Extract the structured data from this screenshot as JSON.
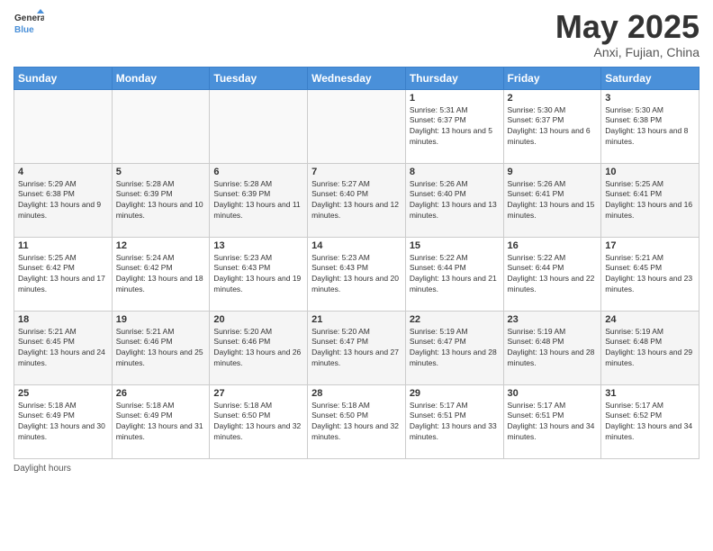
{
  "header": {
    "logo_general": "General",
    "logo_blue": "Blue",
    "month_title": "May 2025",
    "location": "Anxi, Fujian, China"
  },
  "footer": {
    "label": "Daylight hours"
  },
  "days_of_week": [
    "Sunday",
    "Monday",
    "Tuesday",
    "Wednesday",
    "Thursday",
    "Friday",
    "Saturday"
  ],
  "weeks": [
    [
      {
        "day": "",
        "info": ""
      },
      {
        "day": "",
        "info": ""
      },
      {
        "day": "",
        "info": ""
      },
      {
        "day": "",
        "info": ""
      },
      {
        "day": "1",
        "info": "Sunrise: 5:31 AM\nSunset: 6:37 PM\nDaylight: 13 hours and 5 minutes."
      },
      {
        "day": "2",
        "info": "Sunrise: 5:30 AM\nSunset: 6:37 PM\nDaylight: 13 hours and 6 minutes."
      },
      {
        "day": "3",
        "info": "Sunrise: 5:30 AM\nSunset: 6:38 PM\nDaylight: 13 hours and 8 minutes."
      }
    ],
    [
      {
        "day": "4",
        "info": "Sunrise: 5:29 AM\nSunset: 6:38 PM\nDaylight: 13 hours and 9 minutes."
      },
      {
        "day": "5",
        "info": "Sunrise: 5:28 AM\nSunset: 6:39 PM\nDaylight: 13 hours and 10 minutes."
      },
      {
        "day": "6",
        "info": "Sunrise: 5:28 AM\nSunset: 6:39 PM\nDaylight: 13 hours and 11 minutes."
      },
      {
        "day": "7",
        "info": "Sunrise: 5:27 AM\nSunset: 6:40 PM\nDaylight: 13 hours and 12 minutes."
      },
      {
        "day": "8",
        "info": "Sunrise: 5:26 AM\nSunset: 6:40 PM\nDaylight: 13 hours and 13 minutes."
      },
      {
        "day": "9",
        "info": "Sunrise: 5:26 AM\nSunset: 6:41 PM\nDaylight: 13 hours and 15 minutes."
      },
      {
        "day": "10",
        "info": "Sunrise: 5:25 AM\nSunset: 6:41 PM\nDaylight: 13 hours and 16 minutes."
      }
    ],
    [
      {
        "day": "11",
        "info": "Sunrise: 5:25 AM\nSunset: 6:42 PM\nDaylight: 13 hours and 17 minutes."
      },
      {
        "day": "12",
        "info": "Sunrise: 5:24 AM\nSunset: 6:42 PM\nDaylight: 13 hours and 18 minutes."
      },
      {
        "day": "13",
        "info": "Sunrise: 5:23 AM\nSunset: 6:43 PM\nDaylight: 13 hours and 19 minutes."
      },
      {
        "day": "14",
        "info": "Sunrise: 5:23 AM\nSunset: 6:43 PM\nDaylight: 13 hours and 20 minutes."
      },
      {
        "day": "15",
        "info": "Sunrise: 5:22 AM\nSunset: 6:44 PM\nDaylight: 13 hours and 21 minutes."
      },
      {
        "day": "16",
        "info": "Sunrise: 5:22 AM\nSunset: 6:44 PM\nDaylight: 13 hours and 22 minutes."
      },
      {
        "day": "17",
        "info": "Sunrise: 5:21 AM\nSunset: 6:45 PM\nDaylight: 13 hours and 23 minutes."
      }
    ],
    [
      {
        "day": "18",
        "info": "Sunrise: 5:21 AM\nSunset: 6:45 PM\nDaylight: 13 hours and 24 minutes."
      },
      {
        "day": "19",
        "info": "Sunrise: 5:21 AM\nSunset: 6:46 PM\nDaylight: 13 hours and 25 minutes."
      },
      {
        "day": "20",
        "info": "Sunrise: 5:20 AM\nSunset: 6:46 PM\nDaylight: 13 hours and 26 minutes."
      },
      {
        "day": "21",
        "info": "Sunrise: 5:20 AM\nSunset: 6:47 PM\nDaylight: 13 hours and 27 minutes."
      },
      {
        "day": "22",
        "info": "Sunrise: 5:19 AM\nSunset: 6:47 PM\nDaylight: 13 hours and 28 minutes."
      },
      {
        "day": "23",
        "info": "Sunrise: 5:19 AM\nSunset: 6:48 PM\nDaylight: 13 hours and 28 minutes."
      },
      {
        "day": "24",
        "info": "Sunrise: 5:19 AM\nSunset: 6:48 PM\nDaylight: 13 hours and 29 minutes."
      }
    ],
    [
      {
        "day": "25",
        "info": "Sunrise: 5:18 AM\nSunset: 6:49 PM\nDaylight: 13 hours and 30 minutes."
      },
      {
        "day": "26",
        "info": "Sunrise: 5:18 AM\nSunset: 6:49 PM\nDaylight: 13 hours and 31 minutes."
      },
      {
        "day": "27",
        "info": "Sunrise: 5:18 AM\nSunset: 6:50 PM\nDaylight: 13 hours and 32 minutes."
      },
      {
        "day": "28",
        "info": "Sunrise: 5:18 AM\nSunset: 6:50 PM\nDaylight: 13 hours and 32 minutes."
      },
      {
        "day": "29",
        "info": "Sunrise: 5:17 AM\nSunset: 6:51 PM\nDaylight: 13 hours and 33 minutes."
      },
      {
        "day": "30",
        "info": "Sunrise: 5:17 AM\nSunset: 6:51 PM\nDaylight: 13 hours and 34 minutes."
      },
      {
        "day": "31",
        "info": "Sunrise: 5:17 AM\nSunset: 6:52 PM\nDaylight: 13 hours and 34 minutes."
      }
    ]
  ]
}
